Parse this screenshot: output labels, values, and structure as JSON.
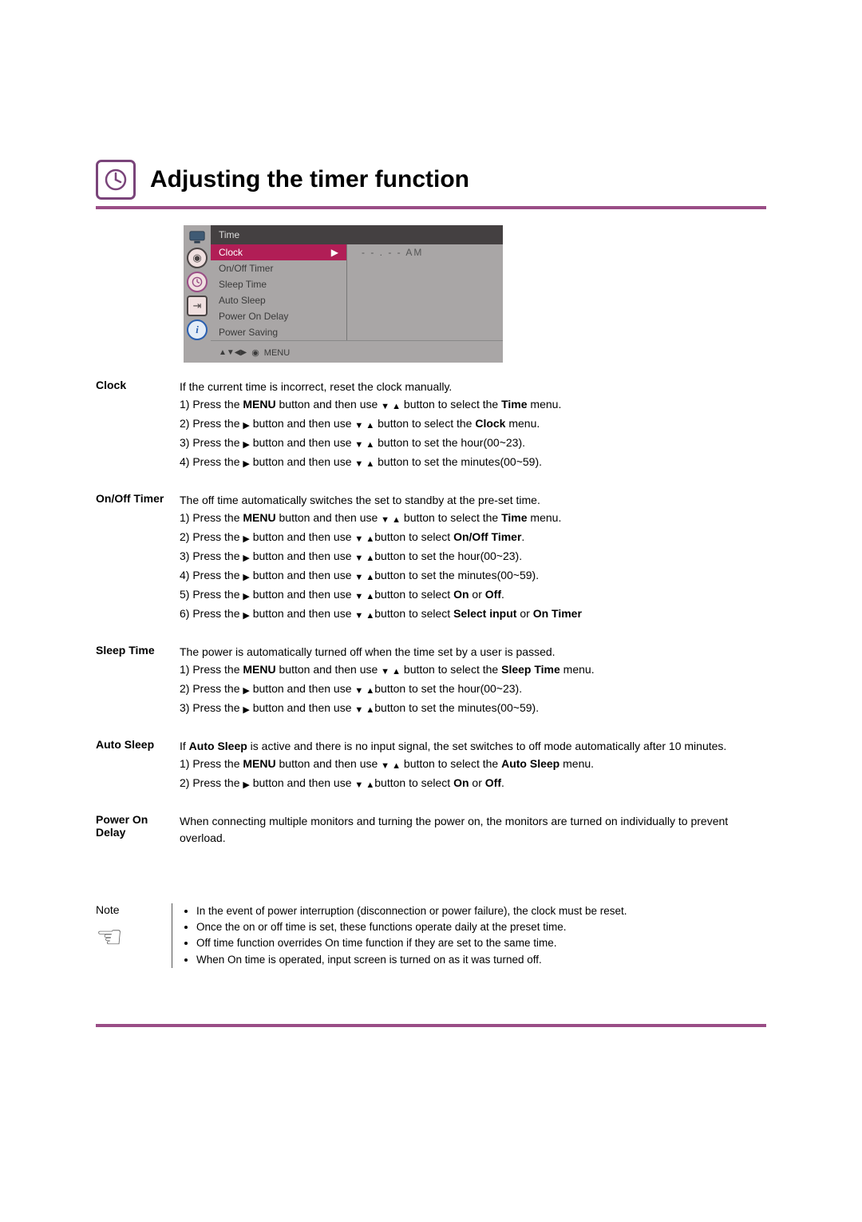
{
  "header": {
    "title": "Adjusting the timer function"
  },
  "osd": {
    "title": "Time",
    "items": [
      "Clock",
      "On/Off Timer",
      "Sleep Time",
      "Auto Sleep",
      "Power On Delay",
      "Power  Saving"
    ],
    "selected_index": 0,
    "clock_value": "- -  .  - -   AM",
    "footer_glyphs": "▲▼◀▶",
    "footer_dot": "◉",
    "footer_label": "MENU"
  },
  "sections": {
    "clock": {
      "label": "Clock",
      "intro": "If the current time is incorrect, reset the clock manually.",
      "s1a": "1) Press the ",
      "s1b": "MENU",
      "s1c": " button and then use ",
      "s1d": " button to select the ",
      "s1e": "Time",
      "s1f": " menu.",
      "s2a": "2) Press the ",
      "s2b": " button and then use ",
      "s2c": " button to select the ",
      "s2d": "Clock",
      "s2e": " menu.",
      "s3a": "3) Press the ",
      "s3b": " button and then use ",
      "s3c": " button to set the hour(00~23).",
      "s4a": "4) Press the ",
      "s4b": " button and then use ",
      "s4c": " button to set the minutes(00~59)."
    },
    "onoff": {
      "label": "On/Off Timer",
      "intro": "The off time automatically switches the set to standby at the pre-set time.",
      "s1a": "1) Press the ",
      "s1b": "MENU",
      "s1c": " button and then use ",
      "s1d": " button to select the ",
      "s1e": "Time",
      "s1f": " menu.",
      "s2a": "2) Press the ",
      "s2b": " button and then use ",
      "s2c": "button to select ",
      "s2d": "On/Off Timer",
      "s2e": ".",
      "s3a": "3) Press the ",
      "s3b": " button and then use ",
      "s3c": "button to set the hour(00~23).",
      "s4a": "4) Press the ",
      "s4b": " button and then use ",
      "s4c": "button to set the minutes(00~59).",
      "s5a": "5) Press the ",
      "s5b": " button and then use ",
      "s5c": "button to select ",
      "s5d": "On",
      "s5e": " or ",
      "s5f": "Off",
      "s5g": ".",
      "s6a": "6) Press the ",
      "s6b": " button and then use ",
      "s6c": "button to select ",
      "s6d": "Select input",
      "s6e": " or ",
      "s6f": "On Timer"
    },
    "sleep": {
      "label": "Sleep Time",
      "intro": "The power is automatically turned off when the time set by a user is passed.",
      "s1a": "1) Press the ",
      "s1b": "MENU",
      "s1c": " button and then use ",
      "s1d": " button to select the ",
      "s1e": "Sleep Time",
      "s1f": " menu.",
      "s2a": "2) Press the ",
      "s2b": " button and then use ",
      "s2c": "button to set the hour(00~23).",
      "s3a": "3) Press the ",
      "s3b": " button and then use ",
      "s3c": "button to set the minutes(00~59)."
    },
    "auto": {
      "label": "Auto Sleep",
      "intro_a": "If ",
      "intro_b": "Auto Sleep",
      "intro_c": " is active and there is no input signal, the set  switches to off mode automatically after 10 minutes.",
      "s1a": "1) Press the ",
      "s1b": "MENU",
      "s1c": " button and then use ",
      "s1d": " button to select the ",
      "s1e": "Auto Sleep",
      "s1f": " menu.",
      "s2a": "2) Press the ",
      "s2b": " button and then use ",
      "s2c": "button to select ",
      "s2d": "On",
      "s2e": " or ",
      "s2f": "Off",
      "s2g": "."
    },
    "delay": {
      "label": "Power On Delay",
      "intro": "When connecting multiple monitors and turning the power on, the monitors are turned on individually to prevent overload."
    }
  },
  "note": {
    "label": "Note",
    "b1": "In the event of power interruption (disconnection or power failure), the clock must be reset.",
    "b2": "Once the on or off time is set, these functions operate daily at the preset time.",
    "b3": "Off time function overrides On time function if they are set to the same time.",
    "b4": "When On time is operated, input screen is turned on as it was turned off."
  },
  "glyphs": {
    "down_up": "▼ ▲",
    "right": "▶"
  }
}
